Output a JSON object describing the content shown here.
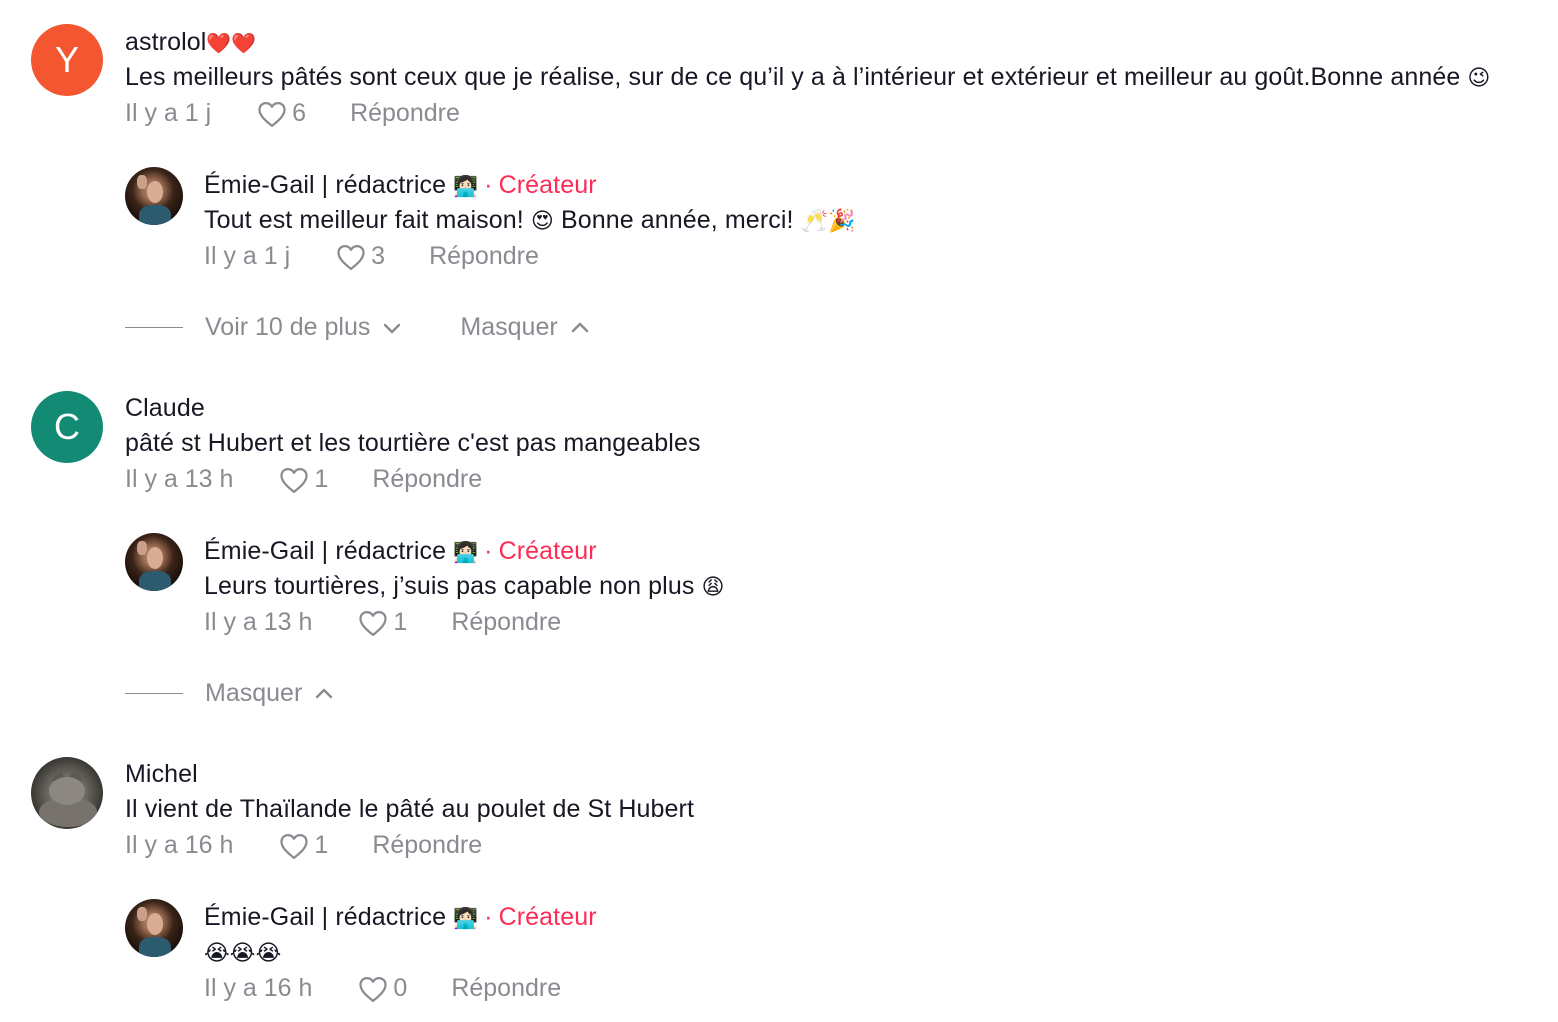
{
  "comments": [
    {
      "avatar_letter": "Y",
      "avatar_color": "#f4562f",
      "username": "astrolol",
      "username_emoji": "❤️❤️",
      "text": "Les meilleurs pâtés sont ceux que je réalise, sur de ce qu’il y a à l’intérieur et extérieur et meilleur au goût.Bonne année",
      "text_emoji": "😉",
      "time": "Il y a 1 j",
      "likes": "6",
      "reply_label": "Répondre",
      "replies": [
        {
          "username": "Émie-Gail | rédactrice",
          "username_emoji": "👩🏻‍💻",
          "creator_label": "Créateur",
          "text": "Tout est meilleur fait maison!",
          "text_emoji_1": "😍",
          "text_2": "Bonne année, merci!",
          "text_emoji_2": "🥂🎉",
          "time": "Il y a 1 j",
          "likes": "3",
          "reply_label": "Répondre"
        }
      ],
      "see_more_label": "Voir 10 de plus",
      "hide_label": "Masquer"
    },
    {
      "avatar_letter": "C",
      "avatar_color": "#128a74",
      "username": "Claude",
      "text": "pâté st Hubert et les tourtière c'est pas mangeables",
      "time": "Il y a 13 h",
      "likes": "1",
      "reply_label": "Répondre",
      "replies": [
        {
          "username": "Émie-Gail | rédactrice",
          "username_emoji": "👩🏻‍💻",
          "creator_label": "Créateur",
          "text": "Leurs tourtières, j’suis pas capable non plus",
          "text_emoji_1": "😩",
          "time": "Il y a 13 h",
          "likes": "1",
          "reply_label": "Répondre"
        }
      ],
      "hide_label": "Masquer"
    },
    {
      "username": "Michel",
      "text": "Il vient de Thaïlande le pâté au poulet de St Hubert",
      "time": "Il y a 16 h",
      "likes": "1",
      "reply_label": "Répondre",
      "replies": [
        {
          "username": "Émie-Gail | rédactrice",
          "username_emoji": "👩🏻‍💻",
          "creator_label": "Créateur",
          "text_emoji_1": "😭😭😭",
          "time": "Il y a 16 h",
          "likes": "0",
          "reply_label": "Répondre"
        }
      ]
    }
  ],
  "colors": {
    "creator": "#fe2c55",
    "meta_gray": "#8a8b91",
    "text": "#161823"
  },
  "icons": {
    "like": "heart-outline-icon",
    "expand": "chevron-down-icon",
    "collapse": "chevron-up-icon"
  }
}
